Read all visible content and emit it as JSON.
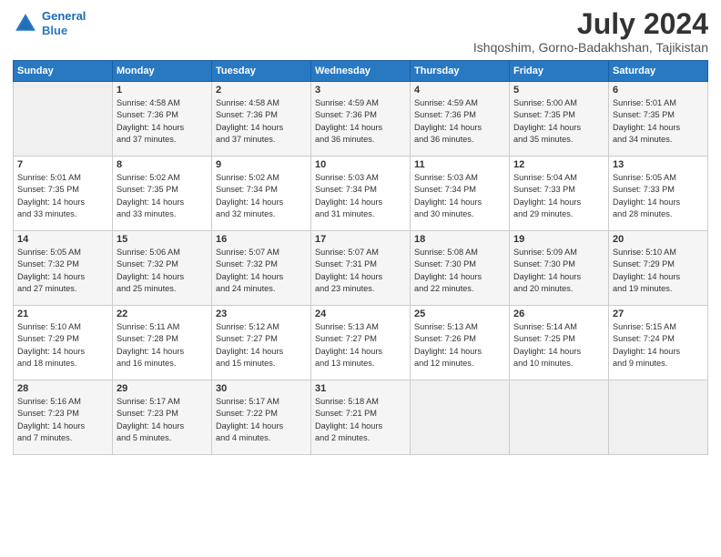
{
  "logo": {
    "line1": "General",
    "line2": "Blue"
  },
  "title": "July 2024",
  "location": "Ishqoshim, Gorno-Badakhshan, Tajikistan",
  "days_of_week": [
    "Sunday",
    "Monday",
    "Tuesday",
    "Wednesday",
    "Thursday",
    "Friday",
    "Saturday"
  ],
  "weeks": [
    [
      {
        "day": "",
        "info": ""
      },
      {
        "day": "1",
        "info": "Sunrise: 4:58 AM\nSunset: 7:36 PM\nDaylight: 14 hours\nand 37 minutes."
      },
      {
        "day": "2",
        "info": "Sunrise: 4:58 AM\nSunset: 7:36 PM\nDaylight: 14 hours\nand 37 minutes."
      },
      {
        "day": "3",
        "info": "Sunrise: 4:59 AM\nSunset: 7:36 PM\nDaylight: 14 hours\nand 36 minutes."
      },
      {
        "day": "4",
        "info": "Sunrise: 4:59 AM\nSunset: 7:36 PM\nDaylight: 14 hours\nand 36 minutes."
      },
      {
        "day": "5",
        "info": "Sunrise: 5:00 AM\nSunset: 7:35 PM\nDaylight: 14 hours\nand 35 minutes."
      },
      {
        "day": "6",
        "info": "Sunrise: 5:01 AM\nSunset: 7:35 PM\nDaylight: 14 hours\nand 34 minutes."
      }
    ],
    [
      {
        "day": "7",
        "info": "Sunrise: 5:01 AM\nSunset: 7:35 PM\nDaylight: 14 hours\nand 33 minutes."
      },
      {
        "day": "8",
        "info": "Sunrise: 5:02 AM\nSunset: 7:35 PM\nDaylight: 14 hours\nand 33 minutes."
      },
      {
        "day": "9",
        "info": "Sunrise: 5:02 AM\nSunset: 7:34 PM\nDaylight: 14 hours\nand 32 minutes."
      },
      {
        "day": "10",
        "info": "Sunrise: 5:03 AM\nSunset: 7:34 PM\nDaylight: 14 hours\nand 31 minutes."
      },
      {
        "day": "11",
        "info": "Sunrise: 5:03 AM\nSunset: 7:34 PM\nDaylight: 14 hours\nand 30 minutes."
      },
      {
        "day": "12",
        "info": "Sunrise: 5:04 AM\nSunset: 7:33 PM\nDaylight: 14 hours\nand 29 minutes."
      },
      {
        "day": "13",
        "info": "Sunrise: 5:05 AM\nSunset: 7:33 PM\nDaylight: 14 hours\nand 28 minutes."
      }
    ],
    [
      {
        "day": "14",
        "info": "Sunrise: 5:05 AM\nSunset: 7:32 PM\nDaylight: 14 hours\nand 27 minutes."
      },
      {
        "day": "15",
        "info": "Sunrise: 5:06 AM\nSunset: 7:32 PM\nDaylight: 14 hours\nand 25 minutes."
      },
      {
        "day": "16",
        "info": "Sunrise: 5:07 AM\nSunset: 7:32 PM\nDaylight: 14 hours\nand 24 minutes."
      },
      {
        "day": "17",
        "info": "Sunrise: 5:07 AM\nSunset: 7:31 PM\nDaylight: 14 hours\nand 23 minutes."
      },
      {
        "day": "18",
        "info": "Sunrise: 5:08 AM\nSunset: 7:30 PM\nDaylight: 14 hours\nand 22 minutes."
      },
      {
        "day": "19",
        "info": "Sunrise: 5:09 AM\nSunset: 7:30 PM\nDaylight: 14 hours\nand 20 minutes."
      },
      {
        "day": "20",
        "info": "Sunrise: 5:10 AM\nSunset: 7:29 PM\nDaylight: 14 hours\nand 19 minutes."
      }
    ],
    [
      {
        "day": "21",
        "info": "Sunrise: 5:10 AM\nSunset: 7:29 PM\nDaylight: 14 hours\nand 18 minutes."
      },
      {
        "day": "22",
        "info": "Sunrise: 5:11 AM\nSunset: 7:28 PM\nDaylight: 14 hours\nand 16 minutes."
      },
      {
        "day": "23",
        "info": "Sunrise: 5:12 AM\nSunset: 7:27 PM\nDaylight: 14 hours\nand 15 minutes."
      },
      {
        "day": "24",
        "info": "Sunrise: 5:13 AM\nSunset: 7:27 PM\nDaylight: 14 hours\nand 13 minutes."
      },
      {
        "day": "25",
        "info": "Sunrise: 5:13 AM\nSunset: 7:26 PM\nDaylight: 14 hours\nand 12 minutes."
      },
      {
        "day": "26",
        "info": "Sunrise: 5:14 AM\nSunset: 7:25 PM\nDaylight: 14 hours\nand 10 minutes."
      },
      {
        "day": "27",
        "info": "Sunrise: 5:15 AM\nSunset: 7:24 PM\nDaylight: 14 hours\nand 9 minutes."
      }
    ],
    [
      {
        "day": "28",
        "info": "Sunrise: 5:16 AM\nSunset: 7:23 PM\nDaylight: 14 hours\nand 7 minutes."
      },
      {
        "day": "29",
        "info": "Sunrise: 5:17 AM\nSunset: 7:23 PM\nDaylight: 14 hours\nand 5 minutes."
      },
      {
        "day": "30",
        "info": "Sunrise: 5:17 AM\nSunset: 7:22 PM\nDaylight: 14 hours\nand 4 minutes."
      },
      {
        "day": "31",
        "info": "Sunrise: 5:18 AM\nSunset: 7:21 PM\nDaylight: 14 hours\nand 2 minutes."
      },
      {
        "day": "",
        "info": ""
      },
      {
        "day": "",
        "info": ""
      },
      {
        "day": "",
        "info": ""
      }
    ]
  ]
}
